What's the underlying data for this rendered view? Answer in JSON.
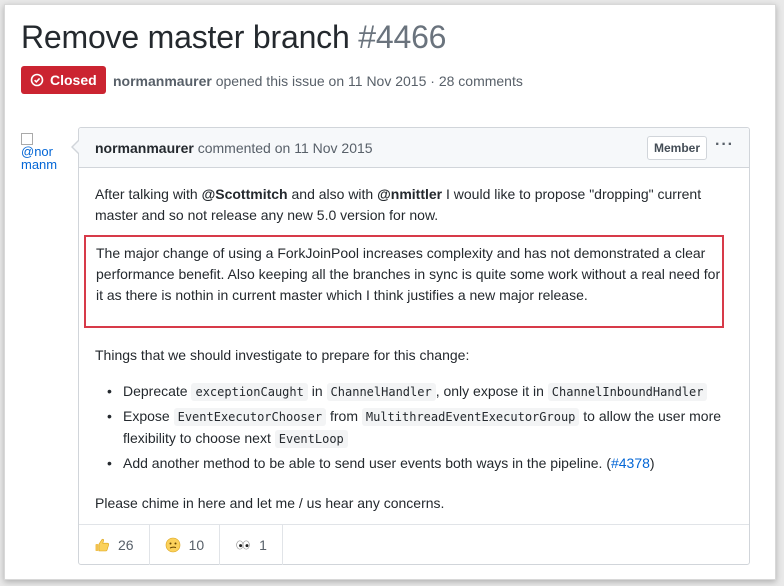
{
  "issue": {
    "title": "Remove master branch",
    "number": "#4466",
    "state_label": "Closed",
    "author": "normanmaurer",
    "opened_text": "opened this issue on 11 Nov 2015 · 28 comments"
  },
  "avatar": {
    "alt_text": "@nor manm"
  },
  "comment": {
    "author": "normanmaurer",
    "action_text": "commented on 11 Nov 2015",
    "role_badge": "Member",
    "menu_label": "···",
    "p1_a": "After talking with ",
    "mention1": "@Scottmitch",
    "p1_b": " and also with ",
    "mention2": "@nmittler",
    "p1_c": " I would like to propose \"dropping\" current master and so not release any new 5.0 version for now.",
    "highlight": "The major change of using a ForkJoinPool increases complexity and has not demonstrated a clear performance benefit. Also keeping all the branches in sync is quite some work without a real need for it as there is nothin in current master which I think justifies a new major release.",
    "p3": "Things that we should investigate to prepare for this change:",
    "bullet1": {
      "a": "Deprecate ",
      "code1": "exceptionCaught",
      "b": " in ",
      "code2": "ChannelHandler",
      "c": ", only expose it in ",
      "code3": "ChannelInboundHandler"
    },
    "bullet2": {
      "a": "Expose ",
      "code1": "EventExecutorChooser",
      "b": " from ",
      "code2": "MultithreadEventExecutorGroup",
      "c": " to allow the user more flexibility to choose next ",
      "code3": "EventLoop"
    },
    "bullet3": {
      "a": "Add another method to be able to send user events both ways in the pipeline. (",
      "link": "#4378",
      "b": ")"
    },
    "p4": "Please chime in here and let me / us hear any concerns."
  },
  "reactions": [
    {
      "icon": "thumbs-up-icon",
      "count": "26"
    },
    {
      "icon": "confused-face-icon",
      "count": "10"
    },
    {
      "icon": "eyes-icon",
      "count": "1"
    }
  ],
  "colors": {
    "closed": "#cb2431",
    "link": "#0366d6",
    "highlight_border": "#d73a49"
  }
}
